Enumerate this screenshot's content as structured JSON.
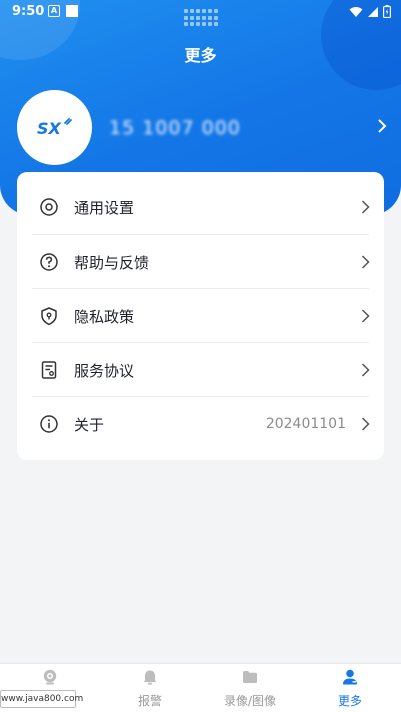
{
  "status_bar": {
    "time": "9:50",
    "notification_letter": "A"
  },
  "header": {
    "title": "更多"
  },
  "profile": {
    "logo_text": "SX",
    "phone": "15 1007 000"
  },
  "menu": [
    {
      "label": "通用设置",
      "icon": "settings-ring-icon",
      "value": ""
    },
    {
      "label": "帮助与反馈",
      "icon": "help-circle-icon",
      "value": ""
    },
    {
      "label": "隐私政策",
      "icon": "privacy-shield-icon",
      "value": ""
    },
    {
      "label": "服务协议",
      "icon": "document-icon",
      "value": ""
    },
    {
      "label": "关于",
      "icon": "info-circle-icon",
      "value": "202401101"
    }
  ],
  "tabs": [
    {
      "label": "",
      "icon": "camera-icon",
      "active": false
    },
    {
      "label": "报警",
      "icon": "bell-icon",
      "active": false
    },
    {
      "label": "录像/图像",
      "icon": "folder-icon",
      "active": false
    },
    {
      "label": "更多",
      "icon": "user-icon",
      "active": true
    }
  ],
  "watermark": "www.java800.com",
  "colors": {
    "accent": "#1677e8",
    "header_gradient_start": "#1f8ff0",
    "header_gradient_end": "#0f6de0",
    "background": "#f3f4f6"
  }
}
